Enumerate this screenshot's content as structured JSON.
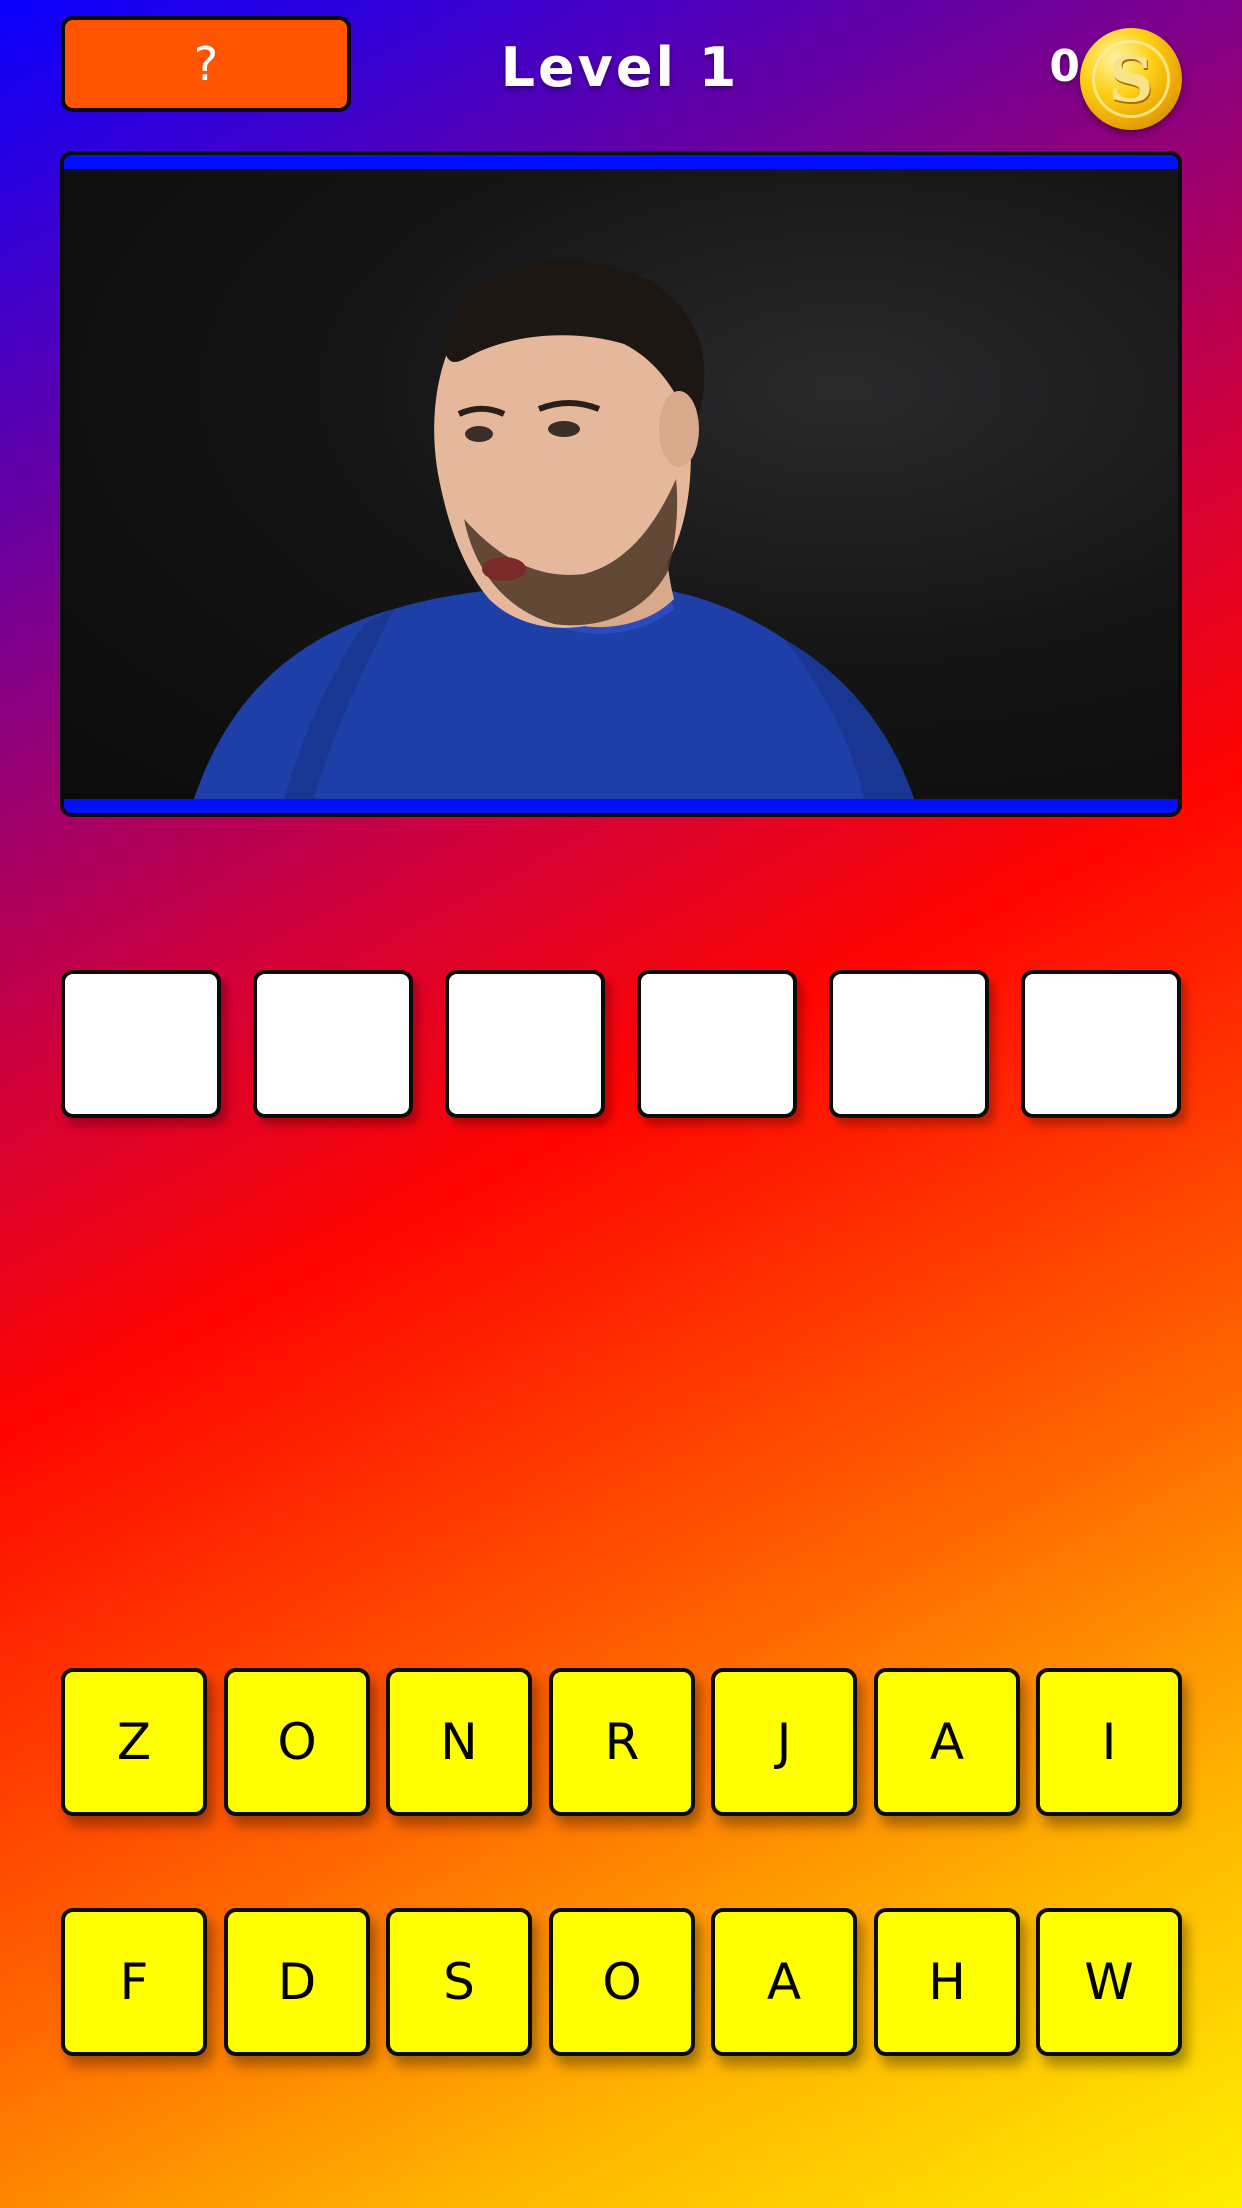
{
  "header": {
    "hint_label": "?",
    "level_title": "Level 1",
    "coin_count": "0",
    "coin_symbol": "S"
  },
  "photo": {
    "icon": "player-photo",
    "frame_color": "#0010ff"
  },
  "answer": {
    "slots": [
      "",
      "",
      "",
      "",
      "",
      ""
    ]
  },
  "keyboard": {
    "row1": [
      "Z",
      "O",
      "N",
      "R",
      "J",
      "A",
      "I"
    ],
    "row2": [
      "F",
      "D",
      "S",
      "O",
      "A",
      "H",
      "W"
    ]
  },
  "colors": {
    "key": "#ffff00",
    "hint_button": "#ff5500",
    "slot": "#ffffff"
  }
}
